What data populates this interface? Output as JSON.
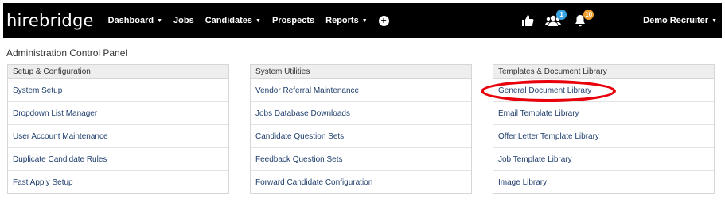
{
  "nav": {
    "brand": "hirebridge",
    "items": [
      {
        "label": "Dashboard",
        "caret": true
      },
      {
        "label": "Jobs",
        "caret": false
      },
      {
        "label": "Candidates",
        "caret": true
      },
      {
        "label": "Prospects",
        "caret": false
      },
      {
        "label": "Reports",
        "caret": true
      }
    ],
    "icons": {
      "thumbs": "thumbs-up-icon",
      "users": "users-icon",
      "users_badge": "1",
      "users_badge_color": "#3aa3e3",
      "bell": "bell-icon",
      "bell_badge": "10",
      "bell_badge_color": "#f0a030"
    },
    "user": "Demo Recruiter"
  },
  "page": {
    "title": "Administration Control Panel"
  },
  "panels": [
    {
      "heading": "Setup & Configuration",
      "items": [
        "System Setup",
        "Dropdown List Manager",
        "User Account Maintenance",
        "Duplicate Candidate Rules",
        "Fast Apply Setup"
      ]
    },
    {
      "heading": "System Utilities",
      "items": [
        "Vendor Referral Maintenance",
        "Jobs Database Downloads",
        "Candidate Question Sets",
        "Feedback Question Sets",
        "Forward Candidate Configuration"
      ]
    },
    {
      "heading": "Templates & Document Library",
      "items": [
        "General Document Library",
        "Email Template Library",
        "Offer Letter Template Library",
        "Job Template Library",
        "Image Library"
      ]
    }
  ],
  "colors": {
    "navbar": "#000000",
    "link": "#1f3e6d",
    "highlight": "#e8000a"
  }
}
